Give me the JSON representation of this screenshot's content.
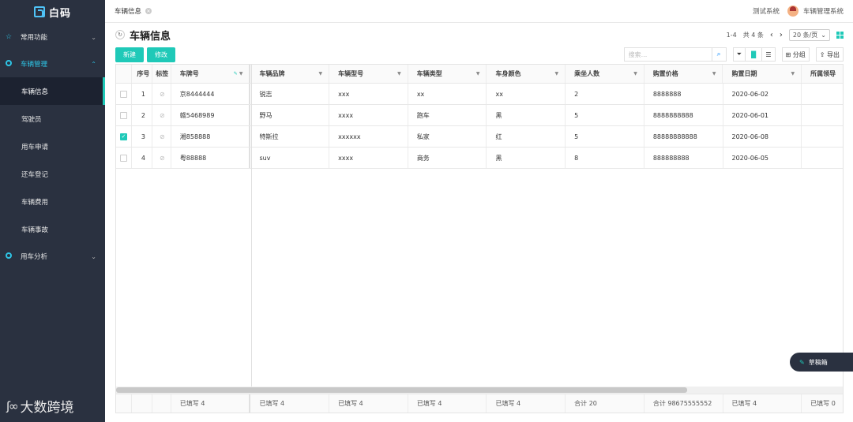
{
  "app": {
    "logo_text": "白码"
  },
  "sidebar": {
    "groups": [
      {
        "label": "常用功能",
        "icon": "star-icon"
      },
      {
        "label": "车辆管理",
        "icon": "circle-icon"
      },
      {
        "label": "用车分析",
        "icon": "circle-icon"
      }
    ],
    "items": [
      "车辆信息",
      "驾驶员",
      "用车申请",
      "还车登记",
      "车辆费用",
      "车辆事故"
    ]
  },
  "watermark": {
    "text": "大数跨境"
  },
  "topbar": {
    "tab_label": "车辆信息",
    "system_label": "测试系统",
    "user_label": "车辆管理系统"
  },
  "page": {
    "title": "车辆信息"
  },
  "pager": {
    "range": "1-4",
    "total": "共 4 条",
    "page_size": "20 条/页"
  },
  "toolbar": {
    "new_label": "新建",
    "edit_label": "修改",
    "search_placeholder": "搜索...",
    "group_label": "分组",
    "export_label": "导出"
  },
  "table": {
    "headers": {
      "no": "序号",
      "tag": "标签",
      "plate": "车牌号",
      "brand": "车辆品牌",
      "model": "车辆型号",
      "type": "车辆类型",
      "color": "车身颜色",
      "seats": "乘坐人数",
      "price": "购置价格",
      "date": "购置日期",
      "dept": "所属领导"
    },
    "rows": [
      {
        "no": "1",
        "checked": false,
        "plate": "京8444444",
        "brand": "锐志",
        "model": "xxx",
        "type": "xx",
        "color": "xx",
        "seats": "2",
        "price": "8888888",
        "date": "2020-06-02",
        "dept": ""
      },
      {
        "no": "2",
        "checked": false,
        "plate": "赣5468989",
        "brand": "野马",
        "model": "xxxx",
        "type": "跑车",
        "color": "黑",
        "seats": "5",
        "price": "8888888888",
        "date": "2020-06-01",
        "dept": ""
      },
      {
        "no": "3",
        "checked": true,
        "plate": "湘858888",
        "brand": "特斯拉",
        "model": "xxxxxx",
        "type": "私家",
        "color": "红",
        "seats": "5",
        "price": "88888888888",
        "date": "2020-06-08",
        "dept": ""
      },
      {
        "no": "4",
        "checked": false,
        "plate": "粤88888",
        "brand": "suv",
        "model": "xxxx",
        "type": "商务",
        "color": "黑",
        "seats": "8",
        "price": "888888888",
        "date": "2020-06-05",
        "dept": ""
      }
    ],
    "footer": {
      "plate": "已填写 4",
      "brand": "已填写 4",
      "model": "已填写 4",
      "type": "已填写 4",
      "color": "已填写 4",
      "seats": "合计 20",
      "price": "合计 98675555552",
      "date": "已填写 4",
      "dept": "已填写 0"
    }
  },
  "draft": {
    "label": "草稿箱"
  }
}
